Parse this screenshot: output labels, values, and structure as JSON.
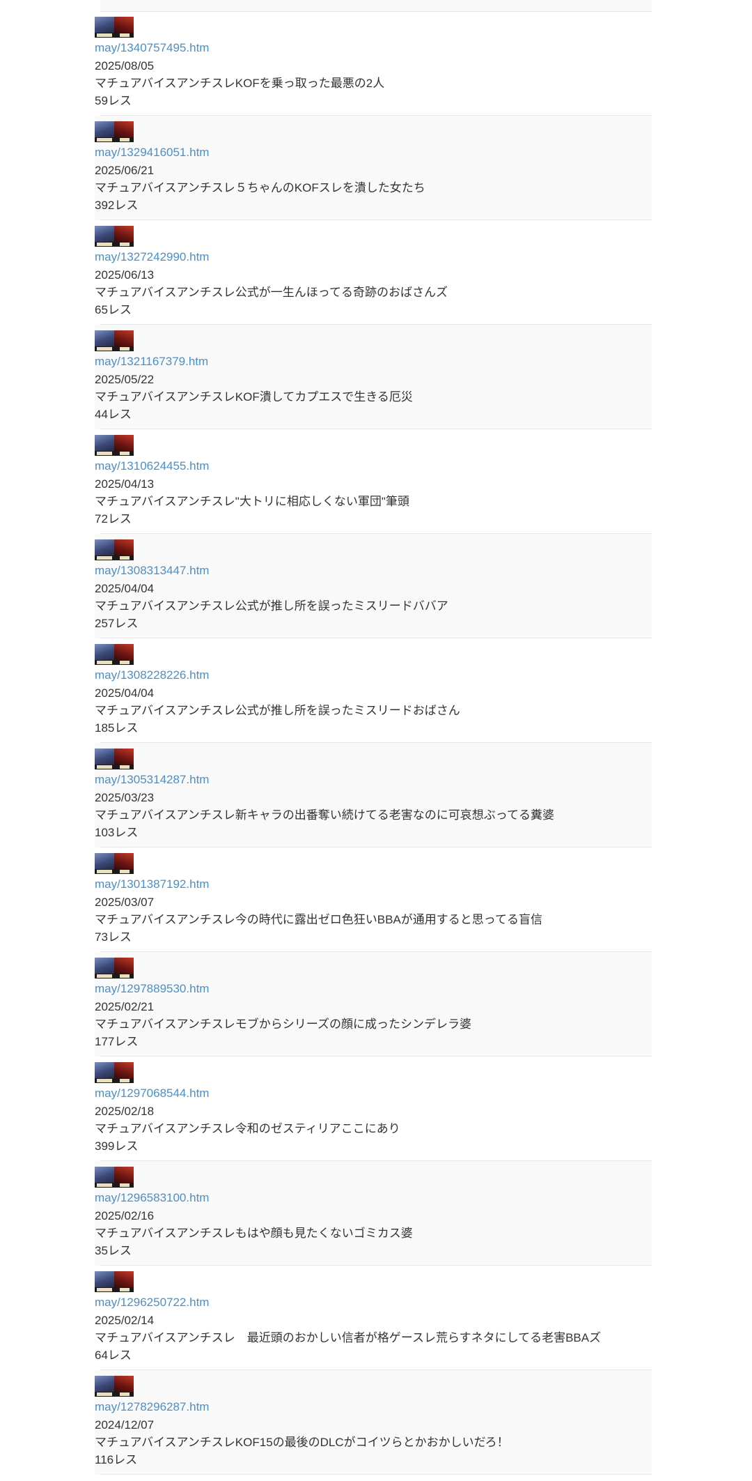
{
  "threads": [
    {
      "link": "may/1340757495.htm",
      "date": "2025/08/05",
      "title": "マチュアバイスアンチスレKOFを乗っ取った最悪の2人",
      "count": "59レス"
    },
    {
      "link": "may/1329416051.htm",
      "date": "2025/06/21",
      "title": "マチュアバイスアンチスレ５ちゃんのKOFスレを潰した女たち",
      "count": "392レス"
    },
    {
      "link": "may/1327242990.htm",
      "date": "2025/06/13",
      "title": "マチュアバイスアンチスレ公式が一生んほってる奇跡のおばさんズ",
      "count": "65レス"
    },
    {
      "link": "may/1321167379.htm",
      "date": "2025/05/22",
      "title": "マチュアバイスアンチスレKOF潰してカプエスで生きる厄災",
      "count": "44レス"
    },
    {
      "link": "may/1310624455.htm",
      "date": "2025/04/13",
      "title": "マチュアバイスアンチスレ\"大トリに相応しくない軍団\"筆頭",
      "count": "72レス"
    },
    {
      "link": "may/1308313447.htm",
      "date": "2025/04/04",
      "title": "マチュアバイスアンチスレ公式が推し所を誤ったミスリードババア",
      "count": "257レス"
    },
    {
      "link": "may/1308228226.htm",
      "date": "2025/04/04",
      "title": "マチュアバイスアンチスレ公式が推し所を誤ったミスリードおばさん",
      "count": "185レス"
    },
    {
      "link": "may/1305314287.htm",
      "date": "2025/03/23",
      "title": "マチュアバイスアンチスレ新キャラの出番奪い続けてる老害なのに可哀想ぶってる糞婆",
      "count": "103レス"
    },
    {
      "link": "may/1301387192.htm",
      "date": "2025/03/07",
      "title": "マチュアバイスアンチスレ今の時代に露出ゼロ色狂いBBAが通用すると思ってる盲信",
      "count": "73レス"
    },
    {
      "link": "may/1297889530.htm",
      "date": "2025/02/21",
      "title": "マチュアバイスアンチスレモブからシリーズの顔に成ったシンデレラ婆",
      "count": "177レス"
    },
    {
      "link": "may/1297068544.htm",
      "date": "2025/02/18",
      "title": "マチュアバイスアンチスレ令和のゼスティリアここにあり",
      "count": "399レス"
    },
    {
      "link": "may/1296583100.htm",
      "date": "2025/02/16",
      "title": "マチュアバイスアンチスレもはや顔も見たくないゴミカス婆",
      "count": "35レス"
    },
    {
      "link": "may/1296250722.htm",
      "date": "2025/02/14",
      "title": "マチュアバイスアンチスレ　最近頭のおかしい信者が格ゲースレ荒らすネタにしてる老害BBAズ",
      "count": "64レス"
    },
    {
      "link": "may/1278296287.htm",
      "date": "2024/12/07",
      "title": "マチュアバイスアンチスレKOF15の最後のDLCがコイツらとかおかしいだろ！",
      "count": "116レス"
    }
  ]
}
